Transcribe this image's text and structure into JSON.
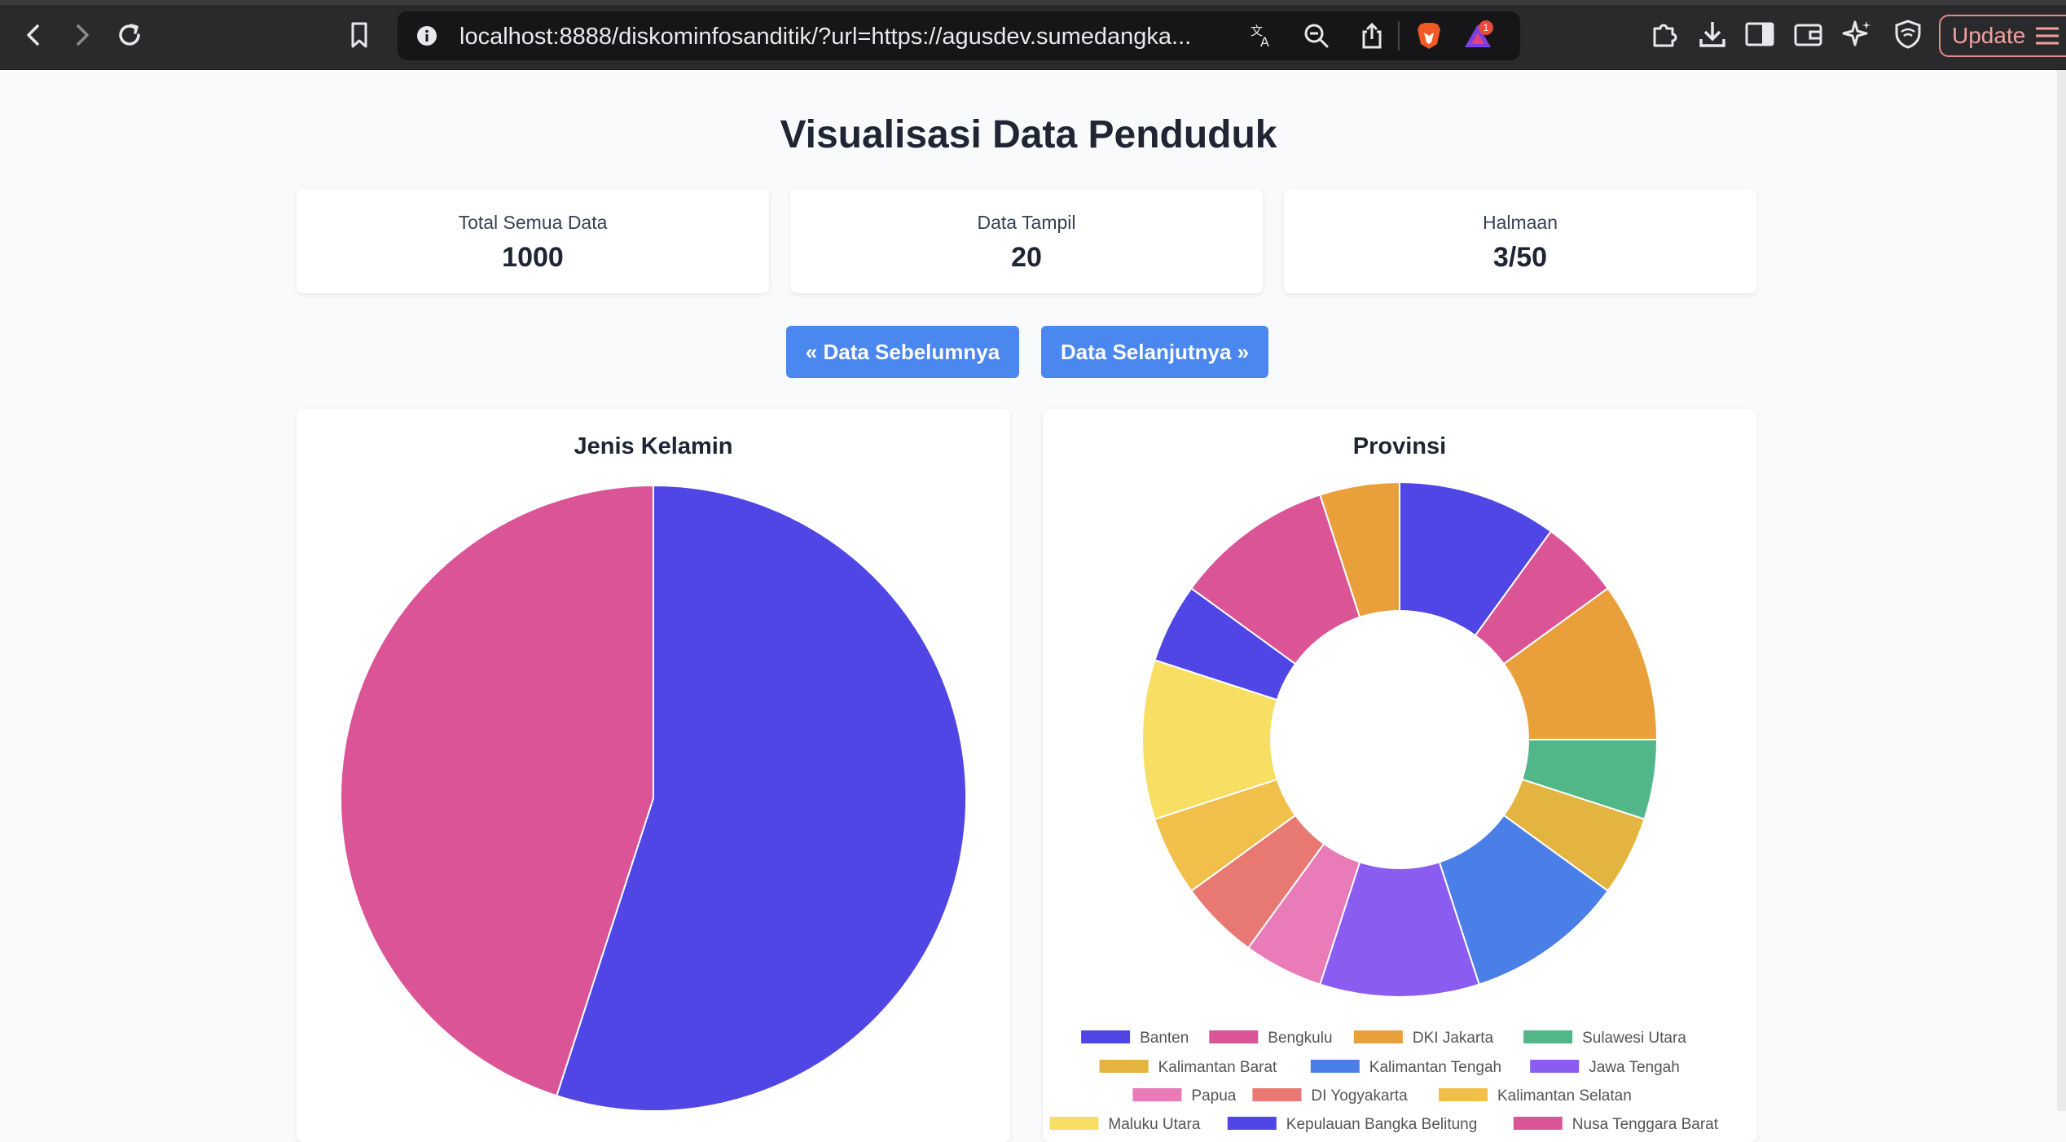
{
  "browser": {
    "url": "localhost:8888/diskominfosanditik/?url=https://agusdev.sumedangka...",
    "update_label": "Update",
    "notification_count": "1"
  },
  "page": {
    "title": "Visualisasi Data Penduduk",
    "stats": [
      {
        "label": "Total Semua Data",
        "value": "1000"
      },
      {
        "label": "Data Tampil",
        "value": "20"
      },
      {
        "label": "Halmaan",
        "value": "3/50"
      }
    ],
    "prev_button": "« Data Sebelumnya",
    "next_button": "Data Selanjutnya »"
  },
  "colors": {
    "accent": "#4a87ee",
    "blue": "#4f46e5",
    "pink": "#db5596",
    "orange": "#e9a03a"
  },
  "chart_data": [
    {
      "type": "pie",
      "title": "Jenis Kelamin",
      "categories": [
        "",
        ""
      ],
      "values": [
        11,
        9
      ],
      "colors": [
        "#4f46e5",
        "#db5596"
      ]
    },
    {
      "type": "doughnut",
      "title": "Provinsi",
      "categories": [
        "Banten",
        "Bengkulu",
        "DKI Jakarta",
        "Sulawesi Utara",
        "Kalimantan Barat",
        "Kalimantan Tengah",
        "Jawa Tengah",
        "Papua",
        "DI Yogyakarta",
        "Kalimantan Selatan",
        "Maluku Utara",
        "Kepulauan Bangka Belitung",
        "Nusa Tenggara Barat",
        "",
        "",
        ""
      ],
      "values": [
        2,
        1,
        2,
        1,
        1,
        2,
        2,
        1,
        1,
        1,
        2,
        1,
        2,
        1,
        0,
        0
      ],
      "colors": [
        "#4f46e5",
        "#db5596",
        "#e9a03a",
        "#52b788",
        "#e3b540",
        "#4a7fe8",
        "#8b5cf0",
        "#e87bb8",
        "#e87872",
        "#f0c04a",
        "#f8de62",
        "#4f46e5",
        "#db5596",
        "#e9a03a",
        "#52b788",
        "#e3b540"
      ],
      "legend_position": "bottom"
    }
  ]
}
